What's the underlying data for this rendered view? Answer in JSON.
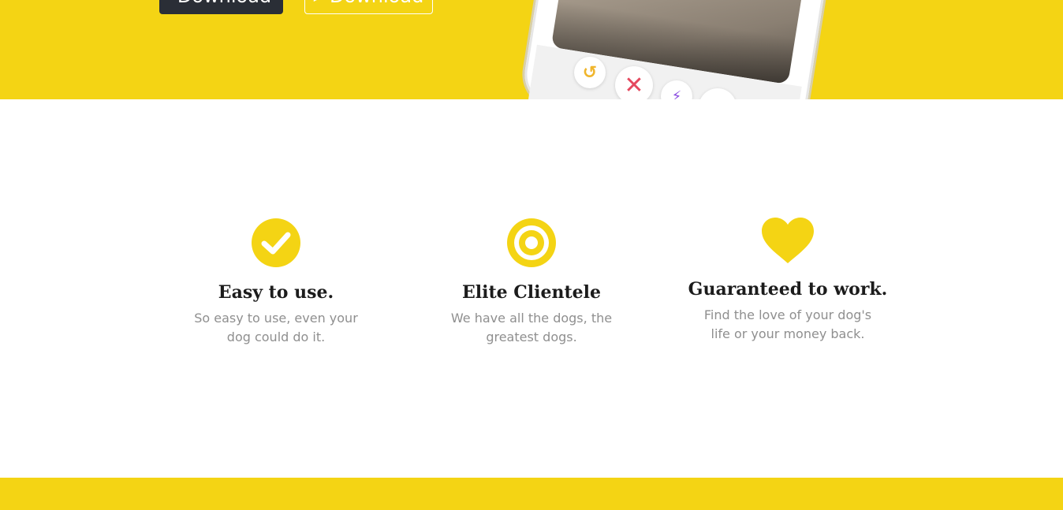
{
  "colors": {
    "brand_yellow": "#F4D414",
    "dark_button": "#2A2E36",
    "title_text": "#1c1c1c",
    "body_text": "#8f8f8f"
  },
  "hero": {
    "primary_button": {
      "label": "Download",
      "icon": "apple-icon"
    },
    "secondary_button": {
      "label": "Download",
      "icon": "google-play-icon"
    },
    "phone_actions": {
      "rewind": "↺",
      "nope": "✕",
      "boost": "⚡",
      "like": "♥"
    }
  },
  "features": [
    {
      "icon": "check-circle-icon",
      "title": "Easy to use.",
      "text": "So easy to use, even your dog could do it."
    },
    {
      "icon": "target-icon",
      "title": "Elite Clientele",
      "text": "We have all the dogs, the greatest dogs."
    },
    {
      "icon": "heart-icon",
      "title": "Guaranteed to work.",
      "text": "Find the love of your dog's life or your money back."
    }
  ]
}
